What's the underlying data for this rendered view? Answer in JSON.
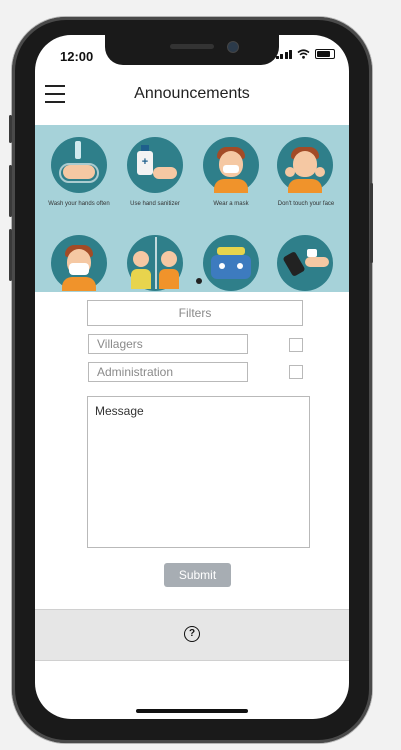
{
  "status_bar": {
    "time": "12:00"
  },
  "header": {
    "title": "Announcements"
  },
  "banner": {
    "captions": [
      "Wash your hands often",
      "Use hand sanitizer",
      "Wear a mask",
      "Don't touch your face"
    ]
  },
  "form": {
    "filters_placeholder": "Filters",
    "villagers_label": "Villagers",
    "administration_label": "Administration",
    "message_placeholder": "Message",
    "submit_label": "Submit"
  },
  "icons": {
    "menu": "hamburger-menu-icon",
    "help": "question-circle-icon"
  }
}
